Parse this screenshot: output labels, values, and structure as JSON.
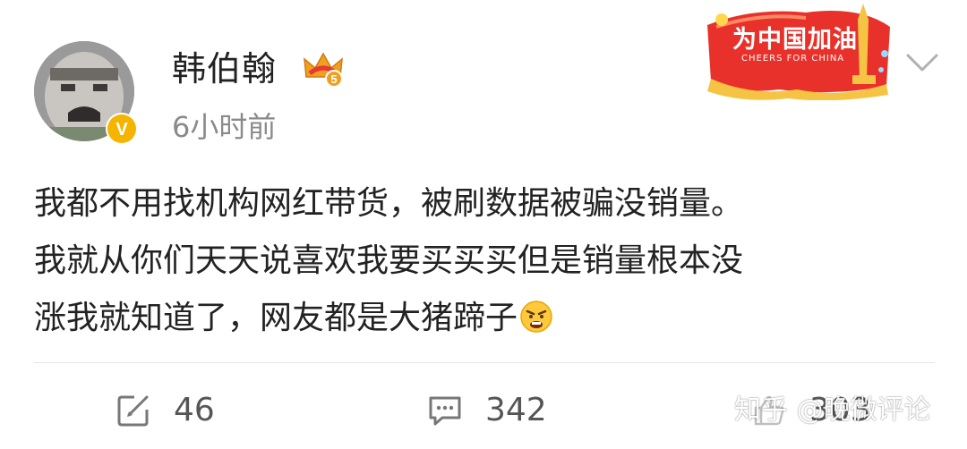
{
  "post": {
    "author": "韩伯翰",
    "time": "6小时前",
    "content_lines": [
      "我都不用找机构网红带货，被刷数据被骗没销量。",
      "我就从你们天天说喜欢我要买买买但是销量根本没",
      "涨我就知道了，网友都是大猪蹄子"
    ],
    "verified_badge": "V",
    "vip_level": "5"
  },
  "banner": {
    "title": "为中国加油",
    "subtitle": "CHEERS FOR CHINA"
  },
  "actions": {
    "repost_count": "46",
    "comment_count": "342",
    "like_count": "303"
  },
  "watermark": "知乎 @晚微评论",
  "icons": {
    "repost": "repost-icon",
    "comment": "comment-icon",
    "like": "like-icon",
    "chevron": "chevron-down-icon",
    "emoji": "angry-face-emoji-icon",
    "vip": "vip-crown-icon"
  },
  "colors": {
    "text": "#222222",
    "meta": "#8a8a8a",
    "action": "#555555",
    "banner_red": "#e8312a",
    "verified_gold": "#f5b400"
  }
}
